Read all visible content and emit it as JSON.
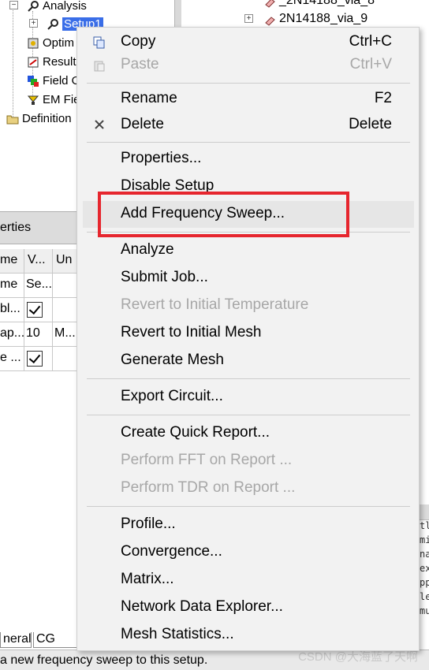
{
  "tree": {
    "analysis": "Analysis",
    "setup": "Setup1",
    "optim": "Optim",
    "results": "Result",
    "field": "Field O",
    "emfield": "EM Fie",
    "definitions": "Definition"
  },
  "right_tree": {
    "item1": "_2N14188_via_8",
    "item2": "2N14188_via_9"
  },
  "properties": {
    "title": "erties",
    "headers": [
      "me",
      "V...",
      "Un"
    ],
    "rows": [
      {
        "c1": "me",
        "c2": "Se...",
        "c3": ""
      },
      {
        "c1": "bl...",
        "c2": "",
        "c3": "",
        "checked": true
      },
      {
        "c1": "ap...",
        "c2": "10",
        "c3": "M..."
      },
      {
        "c1": "e ...",
        "c2": "",
        "c3": "",
        "checked": true
      }
    ]
  },
  "tabs": {
    "general": "neral",
    "cg": "CG"
  },
  "status": "a new frequency sweep to this setup.",
  "watermark": "CSDN @大海蓝了天啊",
  "message_lines": [
    "tl",
    "mi",
    "na",
    "ex",
    "pp",
    "le",
    "mu"
  ],
  "menu": {
    "copy": {
      "label": "Copy",
      "shortcut": "Ctrl+C"
    },
    "paste": {
      "label": "Paste",
      "shortcut": "Ctrl+V"
    },
    "rename": {
      "label": "Rename",
      "shortcut": "F2"
    },
    "delete": {
      "label": "Delete",
      "shortcut": "Delete"
    },
    "properties": "Properties...",
    "disable_setup": "Disable Setup",
    "add_frequency_sweep": "Add Frequency Sweep...",
    "analyze": "Analyze",
    "submit_job": "Submit Job...",
    "revert_temp": "Revert to Initial Temperature",
    "revert_mesh": "Revert to Initial Mesh",
    "generate_mesh": "Generate Mesh",
    "export_circuit": "Export Circuit...",
    "create_quick_report": "Create Quick Report...",
    "perform_fft": "Perform FFT on Report ...",
    "perform_tdr": "Perform TDR on Report ...",
    "profile": "Profile...",
    "convergence": "Convergence...",
    "matrix": "Matrix...",
    "network_data_explorer": "Network Data Explorer...",
    "mesh_statistics": "Mesh Statistics..."
  },
  "colors": {
    "highlight_box": "#e6262e",
    "selection": "#3a6ee8"
  }
}
